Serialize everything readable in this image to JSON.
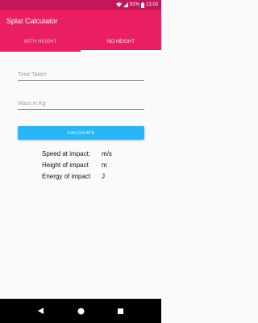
{
  "status_bar": {
    "battery": "91%",
    "time": "13:03",
    "icons": [
      "wifi-icon",
      "signal-icon",
      "battery-icon"
    ]
  },
  "app_bar": {
    "title": "Splat Calculator"
  },
  "tabs": [
    {
      "label": "WITH HEIGHT",
      "active": false
    },
    {
      "label": "NO HEIGHT",
      "active": true
    }
  ],
  "form": {
    "time_placeholder": "Time Taken",
    "time_value": "",
    "mass_placeholder": "Mass in Kg",
    "mass_value": "",
    "calculate_label": "CALCULATE"
  },
  "results": {
    "speed_label": "Speed at impact:",
    "speed_unit": "m/s",
    "height_label": "Height of impact",
    "height_unit": "m",
    "energy_label": "Energy of impact",
    "energy_unit": "J"
  },
  "nav": {
    "icons": [
      "back-icon",
      "home-icon",
      "recents-icon"
    ]
  },
  "colors": {
    "primary": "#e91e63",
    "primary_dark": "#c2185b",
    "accent": "#29b6f6"
  }
}
